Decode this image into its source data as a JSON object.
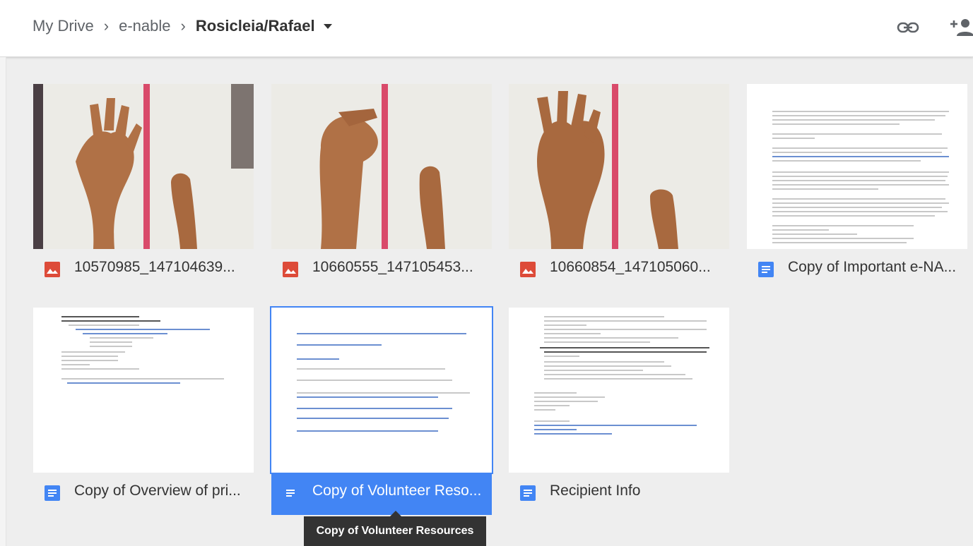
{
  "breadcrumb": {
    "items": [
      "My Drive",
      "e-nable",
      "Rosicleia/Rafael"
    ]
  },
  "toolbar": {
    "link_icon": "link-icon",
    "share_icon": "add-person-icon"
  },
  "files": [
    {
      "name": "10570985_147104639...",
      "type": "image",
      "icon": "image-icon"
    },
    {
      "name": "10660555_147105453...",
      "type": "image",
      "icon": "image-icon"
    },
    {
      "name": "10660854_147105060...",
      "type": "image",
      "icon": "image-icon"
    },
    {
      "name": "Copy of Important e-NA...",
      "type": "doc",
      "icon": "doc-icon"
    },
    {
      "name": "Copy of Overview of pri...",
      "type": "doc",
      "icon": "doc-icon"
    },
    {
      "name": "Copy of Volunteer Reso...",
      "type": "doc",
      "icon": "doc-icon",
      "selected": true
    },
    {
      "name": "Recipient Info",
      "type": "doc",
      "icon": "doc-icon"
    }
  ],
  "tooltip": "Copy of Volunteer Resources",
  "colors": {
    "selected": "#4285f4",
    "image_icon": "#dd4b39",
    "doc_icon": "#4285f4"
  }
}
